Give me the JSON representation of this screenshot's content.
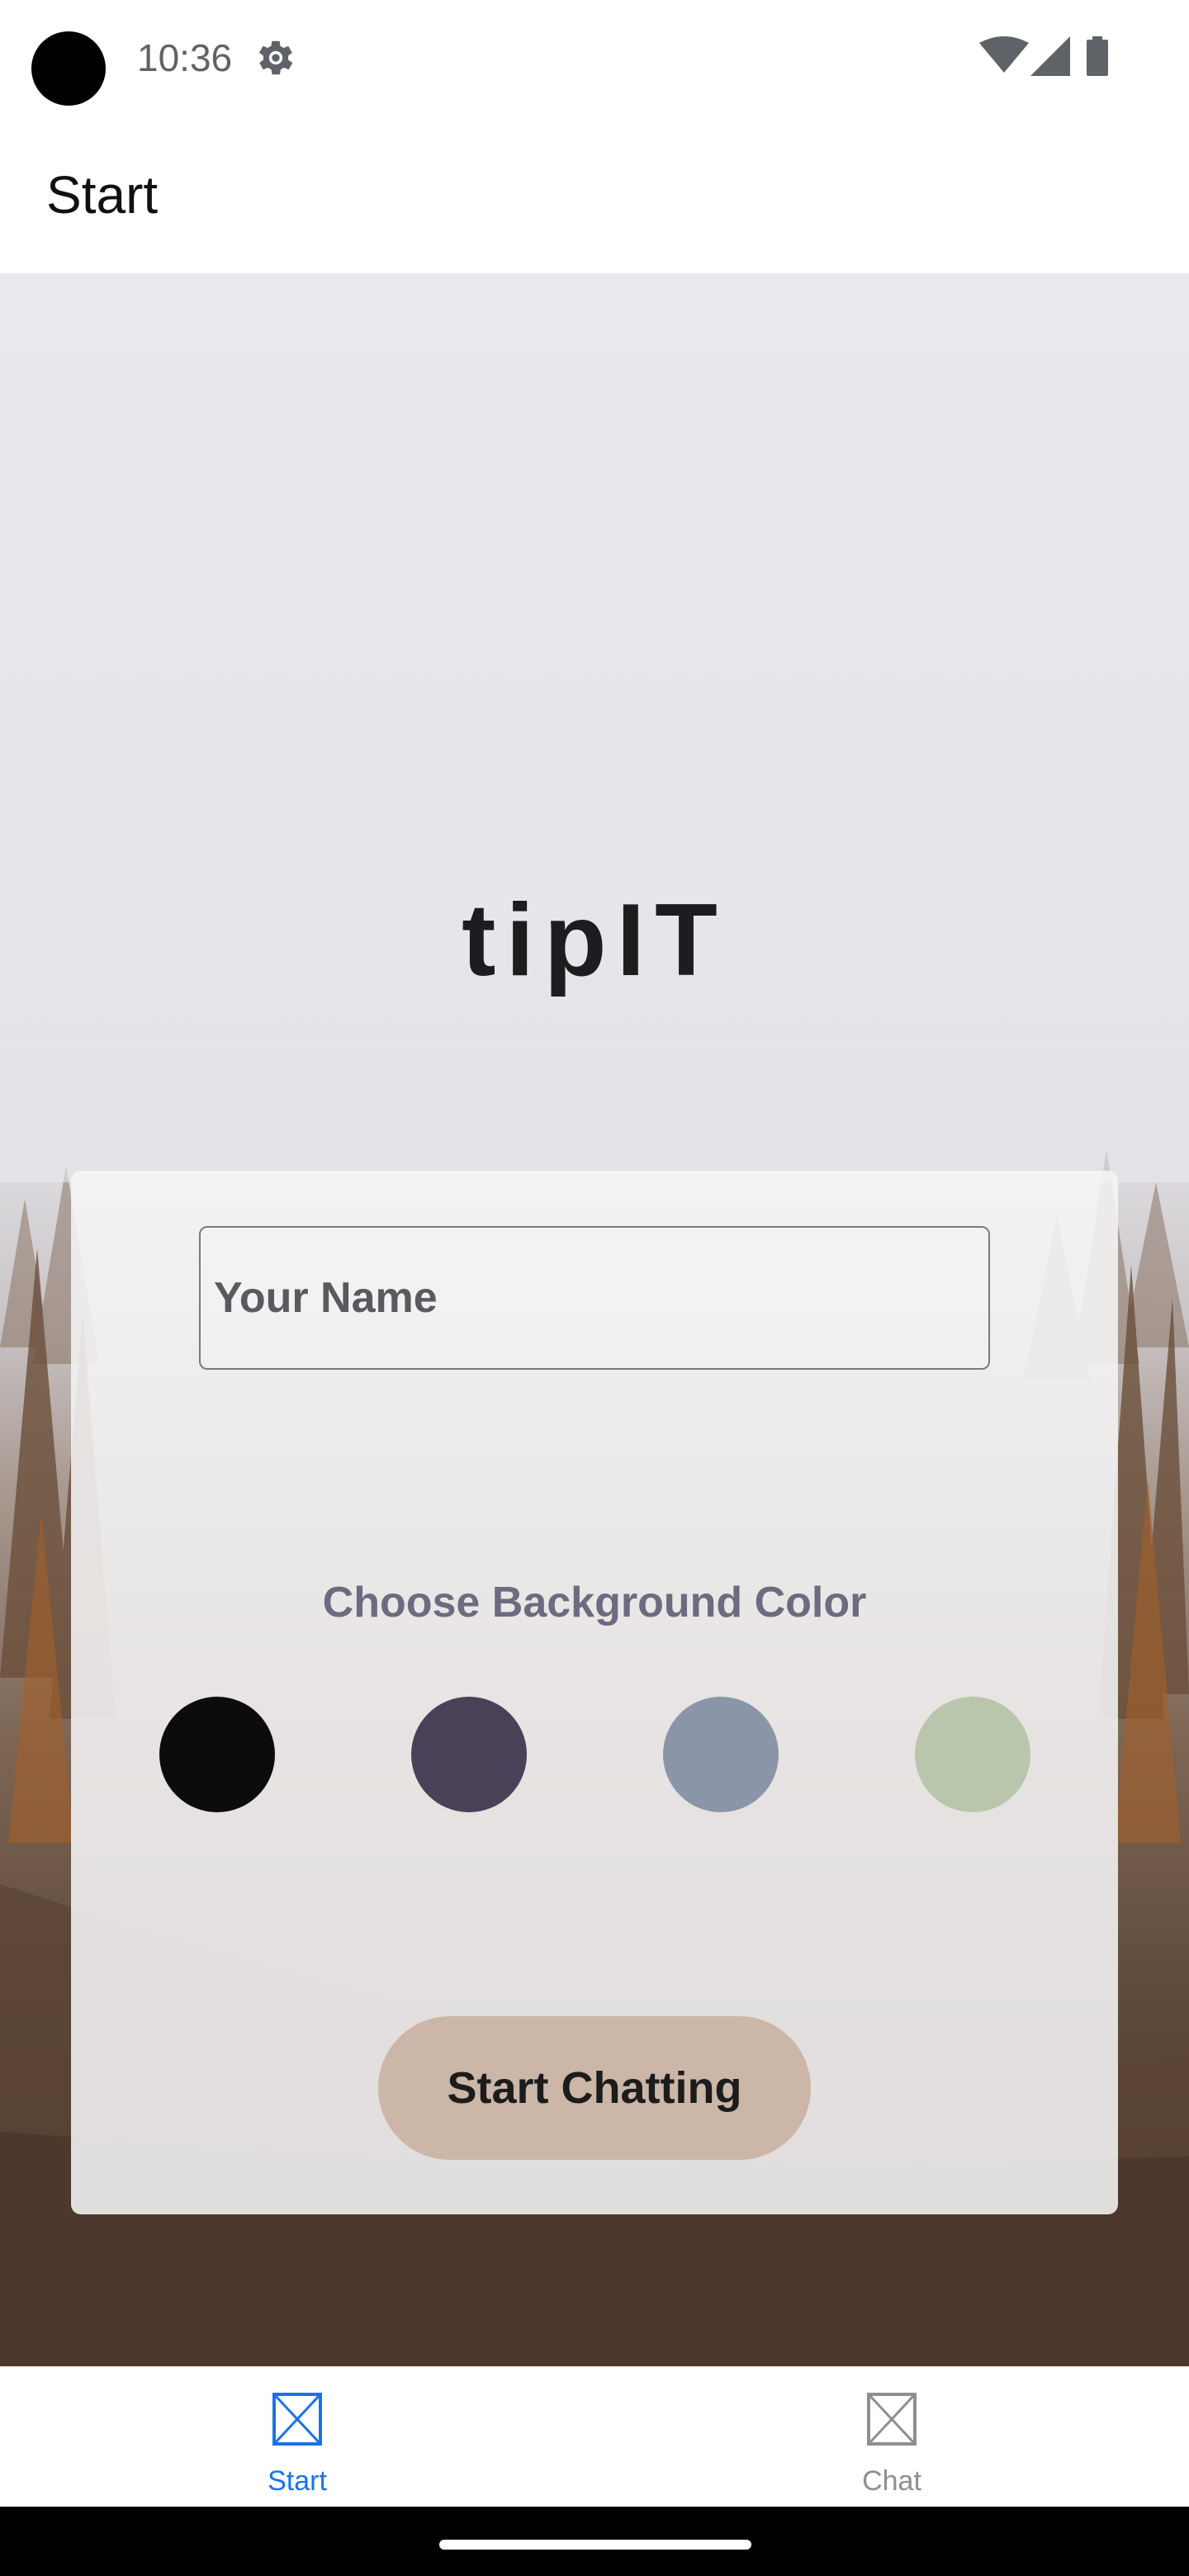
{
  "status_bar": {
    "time": "10:36",
    "icons": [
      "camera-dot",
      "gear-icon",
      "wifi-icon",
      "signal-icon",
      "battery-icon"
    ]
  },
  "header": {
    "title": "Start"
  },
  "hero": {
    "logo_text": "tipIT"
  },
  "form": {
    "name_placeholder": "Your Name",
    "name_value": "",
    "color_label": "Choose Background Color",
    "colors": [
      "#0b0c0b",
      "#484158",
      "#8a96a8",
      "#b9c6ab"
    ],
    "start_button": "Start Chatting",
    "start_button_color": "#cbb6a7"
  },
  "tabs": [
    {
      "label": "Start",
      "icon": "image-placeholder-icon",
      "active": true,
      "color": "#1a73e8"
    },
    {
      "label": "Chat",
      "icon": "image-placeholder-icon",
      "active": false,
      "color": "#8e8e93"
    }
  ]
}
